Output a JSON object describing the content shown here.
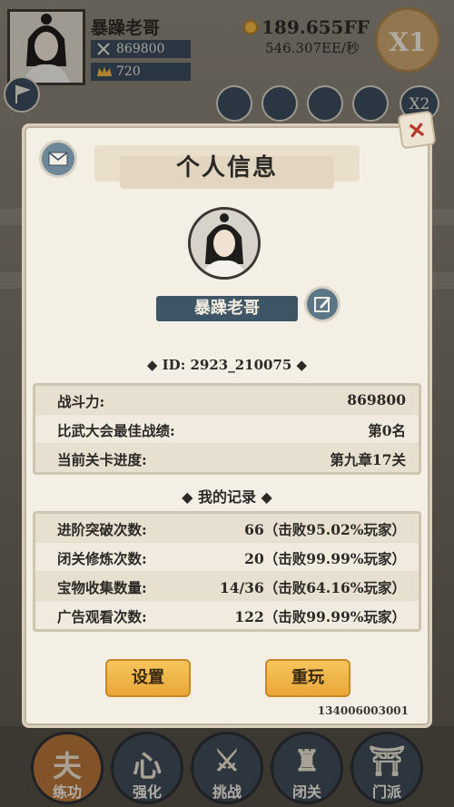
{
  "hud": {
    "player_name": "暴躁老哥",
    "power": "869800",
    "ingot": "720",
    "gold": "189.655FF",
    "gold_rate": "546.307EE/秒",
    "speed_button": "X1",
    "speed_button_2": "X2"
  },
  "panel": {
    "title": "个人信息",
    "player_name": "暴躁老哥",
    "id_line": "◆ ID: 2923_210075 ◆",
    "stats": [
      {
        "label": "战斗力:",
        "value": "869800"
      },
      {
        "label": "比武大会最佳战绩:",
        "value": "第0名"
      },
      {
        "label": "当前关卡进度:",
        "value": "第九章17关"
      }
    ],
    "records_title": "◆ 我的记录 ◆",
    "records": [
      {
        "label": "进阶突破次数:",
        "value": "66（击败95.02%玩家）"
      },
      {
        "label": "闭关修炼次数:",
        "value": "20（击败99.99%玩家）"
      },
      {
        "label": "宝物收集数量:",
        "value": "14/36（击败64.16%玩家）"
      },
      {
        "label": "广告观看次数:",
        "value": "122（击败99.99%玩家）"
      }
    ],
    "settings_button": "设置",
    "replay_button": "重玩",
    "footer_code": "134006003001"
  },
  "bottom_nav": [
    {
      "label": "练功",
      "glyph": "夫",
      "active": true
    },
    {
      "label": "强化",
      "glyph": "心",
      "active": false
    },
    {
      "label": "挑战",
      "glyph": "⚔",
      "active": false
    },
    {
      "label": "闭关",
      "glyph": "♜",
      "active": false
    },
    {
      "label": "门派",
      "glyph": "⛩",
      "active": false
    }
  ],
  "colors": {
    "accent_gold": "#f0b445",
    "plate_blue": "#3e5566",
    "panel_bg": "#f4efe4",
    "close_red": "#b9372a"
  }
}
